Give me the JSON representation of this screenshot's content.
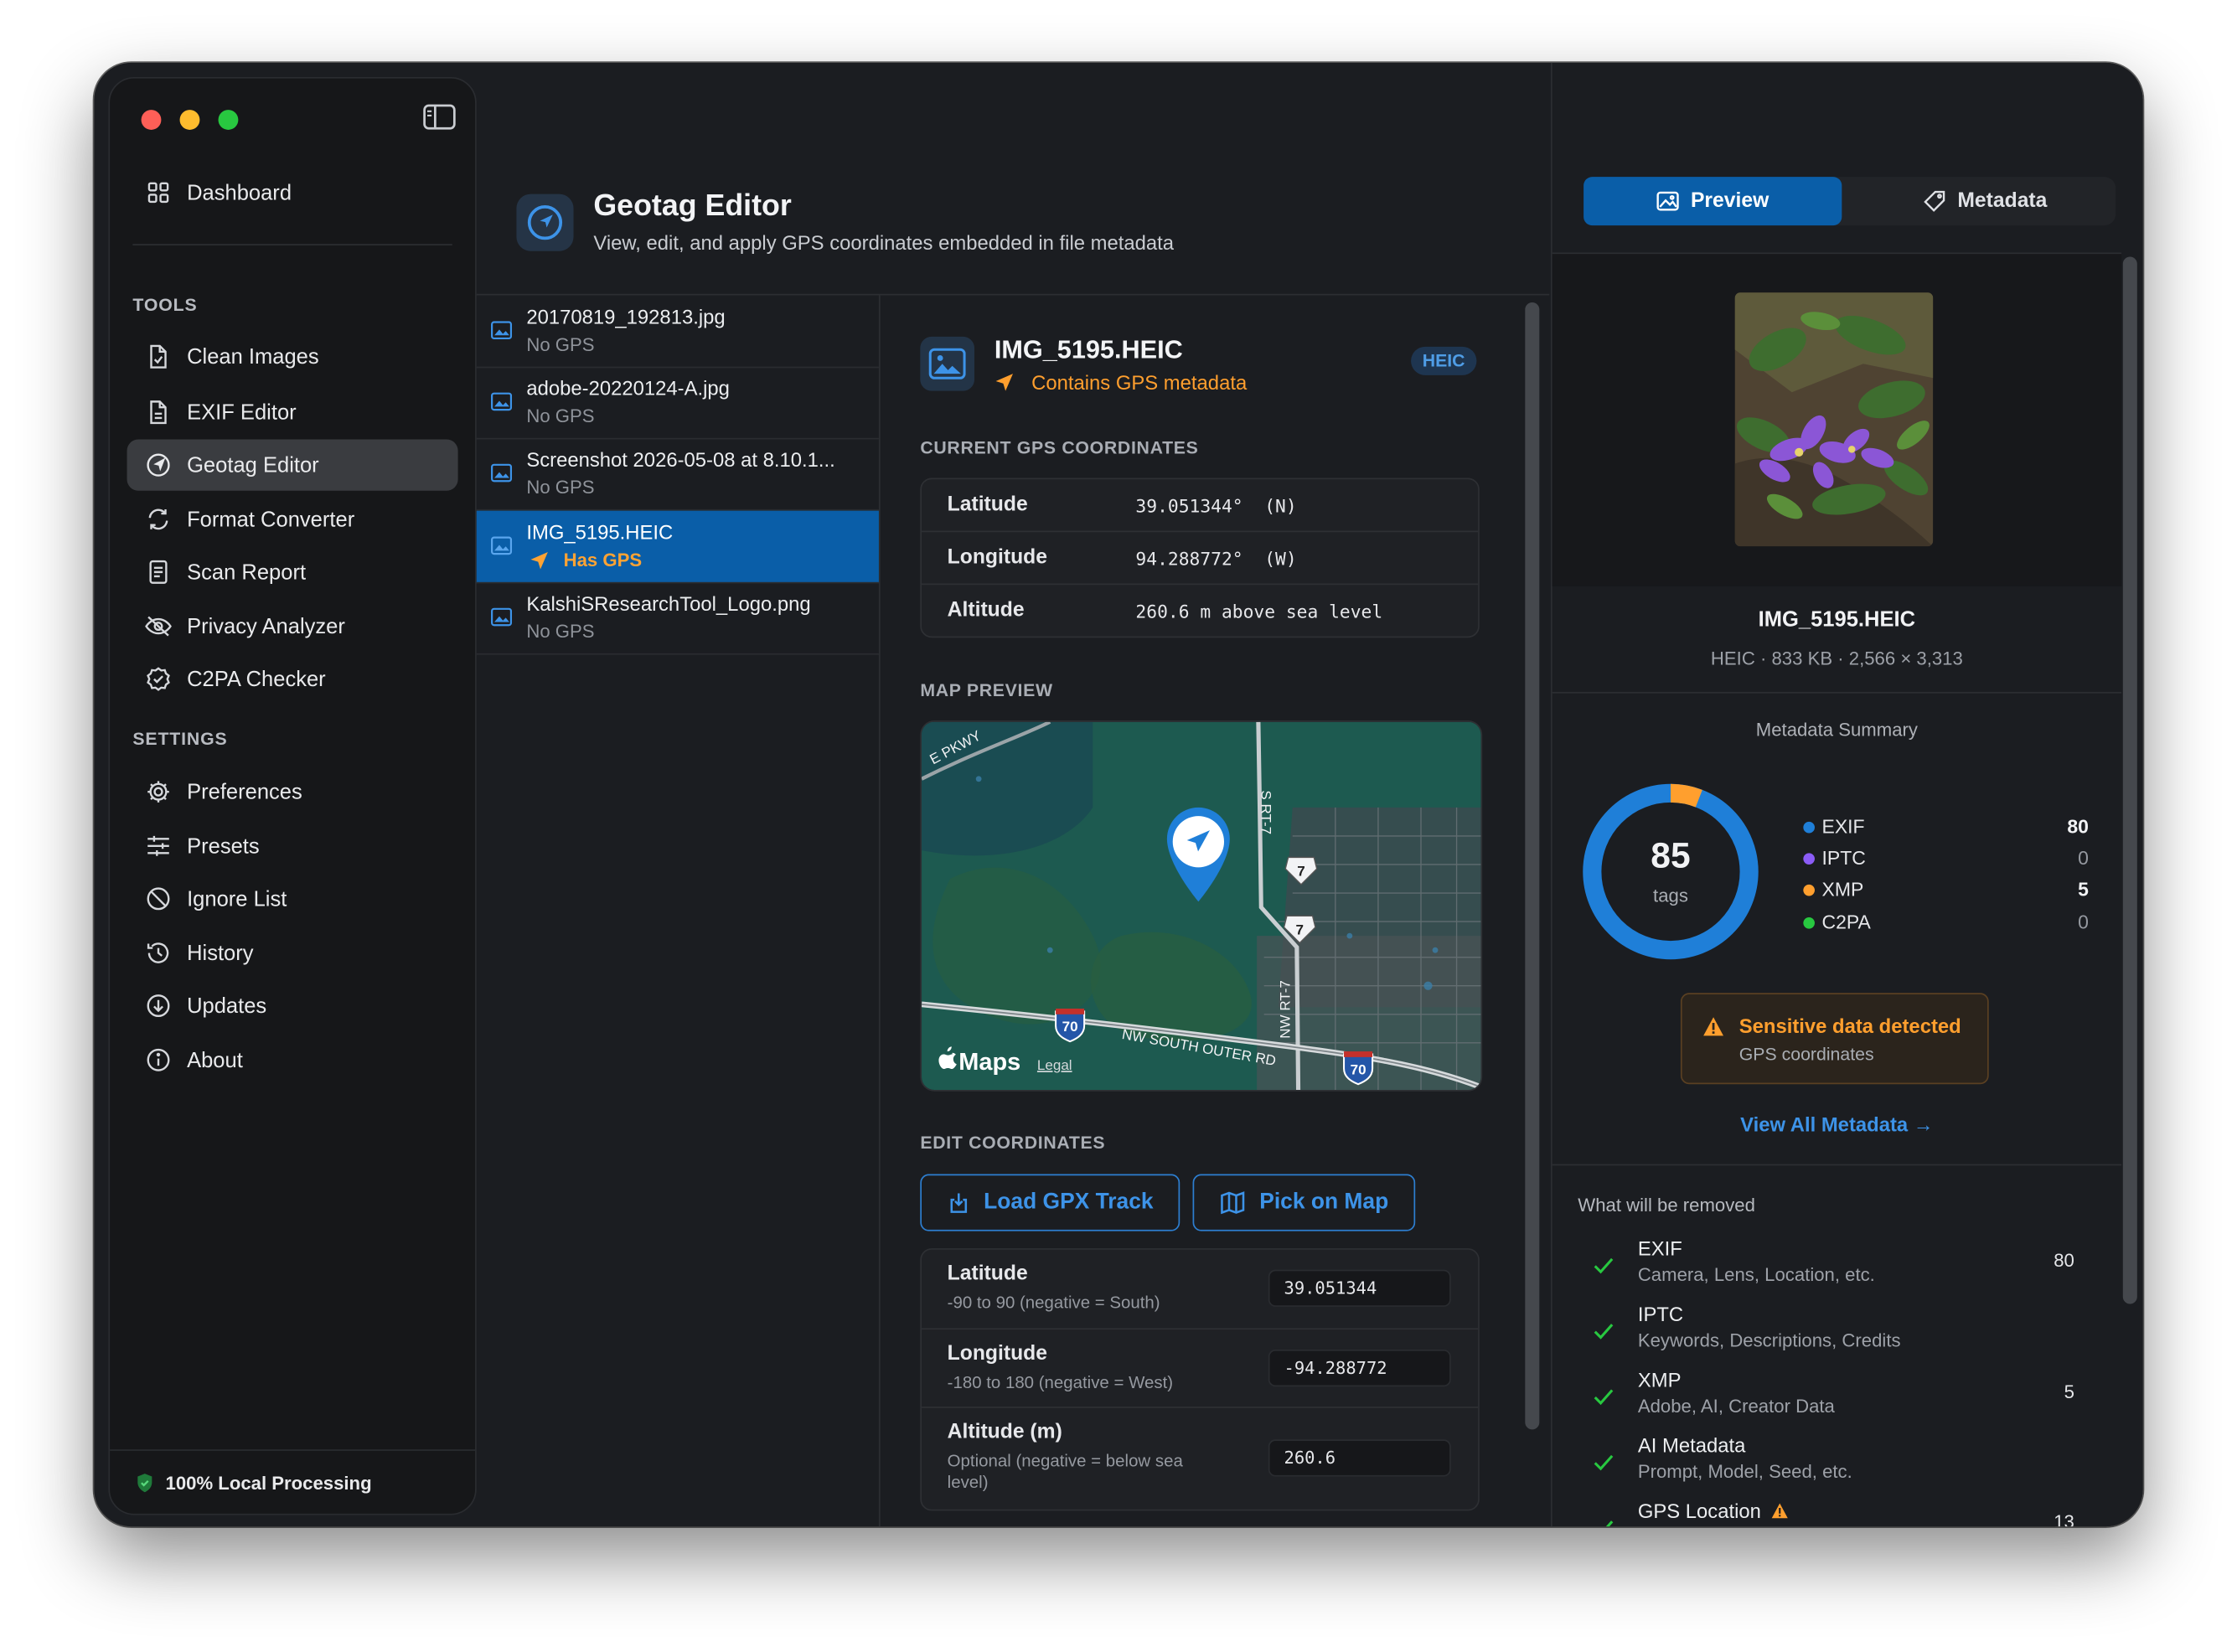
{
  "sidebar": {
    "dashboard": "Dashboard",
    "tools_heading": "TOOLS",
    "tools": [
      {
        "label": "Clean Images",
        "icon": "document-icon"
      },
      {
        "label": "EXIF Editor",
        "icon": "document-edit-icon"
      },
      {
        "label": "Geotag Editor",
        "icon": "location-icon",
        "active": true
      },
      {
        "label": "Format Converter",
        "icon": "convert-icon"
      },
      {
        "label": "Scan Report",
        "icon": "report-icon"
      },
      {
        "label": "Privacy Analyzer",
        "icon": "eye-slash-icon"
      },
      {
        "label": "C2PA Checker",
        "icon": "shield-check-icon"
      }
    ],
    "settings_heading": "SETTINGS",
    "settings": [
      {
        "label": "Preferences",
        "icon": "gear-icon"
      },
      {
        "label": "Presets",
        "icon": "sliders-icon"
      },
      {
        "label": "Ignore List",
        "icon": "prohibited-icon"
      },
      {
        "label": "History",
        "icon": "history-icon"
      },
      {
        "label": "Updates",
        "icon": "download-icon"
      },
      {
        "label": "About",
        "icon": "info-icon"
      }
    ],
    "footer": "100% Local Processing"
  },
  "header": {
    "title": "Geotag Editor",
    "subtitle": "View, edit, and apply GPS coordinates embedded in file metadata"
  },
  "files": [
    {
      "name": "20170819_192813.jpg",
      "status": "No GPS"
    },
    {
      "name": "adobe-20220124-A.jpg",
      "status": "No GPS"
    },
    {
      "name": "Screenshot 2026-05-08 at 8.10.1...",
      "status": "No GPS"
    },
    {
      "name": "IMG_5195.HEIC",
      "status": "Has GPS",
      "selected": true
    },
    {
      "name": "KalshiSResearchTool_Logo.png",
      "status": "No GPS"
    }
  ],
  "detail": {
    "filename": "IMG_5195.HEIC",
    "gps_note": "Contains GPS metadata",
    "format_badge": "HEIC",
    "current_heading": "CURRENT GPS COORDINATES",
    "current": [
      {
        "label": "Latitude",
        "value": "39.051344°  (N)"
      },
      {
        "label": "Longitude",
        "value": "94.288772°  (W)"
      },
      {
        "label": "Altitude",
        "value": "260.6 m above sea level"
      }
    ],
    "map_heading": "MAP PREVIEW",
    "map": {
      "road_pkwy": "E PKWY",
      "road_srt7": "S RT-7",
      "road_nwrt7": "NW RT-7",
      "road_outer": "NW SOUTH OUTER RD",
      "shield_70": "70",
      "shield_7": "7",
      "brand": "Maps",
      "legal": "Legal"
    },
    "edit_heading": "EDIT COORDINATES",
    "load_gpx": "Load GPX Track",
    "pick_map": "Pick on Map",
    "edit": [
      {
        "label": "Latitude",
        "hint": "-90 to 90  (negative = South)",
        "value": "39.051344"
      },
      {
        "label": "Longitude",
        "hint": "-180 to 180  (negative = West)",
        "value": "-94.288772"
      },
      {
        "label": "Altitude (m)",
        "hint": "Optional  (negative = below sea level)",
        "value": "260.6"
      }
    ]
  },
  "panel": {
    "tab_preview": "Preview",
    "tab_metadata": "Metadata",
    "filename": "IMG_5195.HEIC",
    "meta_line": "HEIC  ·  833 KB  ·  2,566 × 3,313",
    "summary_title": "Metadata Summary",
    "total": "85",
    "total_label": "tags",
    "legend": [
      {
        "name": "EXIF",
        "value": "80",
        "color": "#1f7fd8"
      },
      {
        "name": "IPTC",
        "value": "0",
        "color": "#8b5cf6"
      },
      {
        "name": "XMP",
        "value": "5",
        "color": "#ff9f2e"
      },
      {
        "name": "C2PA",
        "value": "0",
        "color": "#28c840"
      }
    ],
    "warning_title": "Sensitive data detected",
    "warning_sub": "GPS coordinates",
    "view_all": "View All Metadata →",
    "removed_title": "What will be removed",
    "removed": [
      {
        "name": "EXIF",
        "desc": "Camera, Lens, Location, etc.",
        "count": "80"
      },
      {
        "name": "IPTC",
        "desc": "Keywords, Descriptions, Credits",
        "count": ""
      },
      {
        "name": "XMP",
        "desc": "Adobe, AI, Creator Data",
        "count": "5"
      },
      {
        "name": "AI Metadata",
        "desc": "Prompt, Model, Seed, etc.",
        "count": ""
      },
      {
        "name": "GPS Location",
        "desc": "",
        "count": "13"
      }
    ]
  },
  "colors": {
    "accent": "#0a5ea8",
    "link": "#3d93e8",
    "warning": "#ff9f2e",
    "success": "#28c840"
  }
}
